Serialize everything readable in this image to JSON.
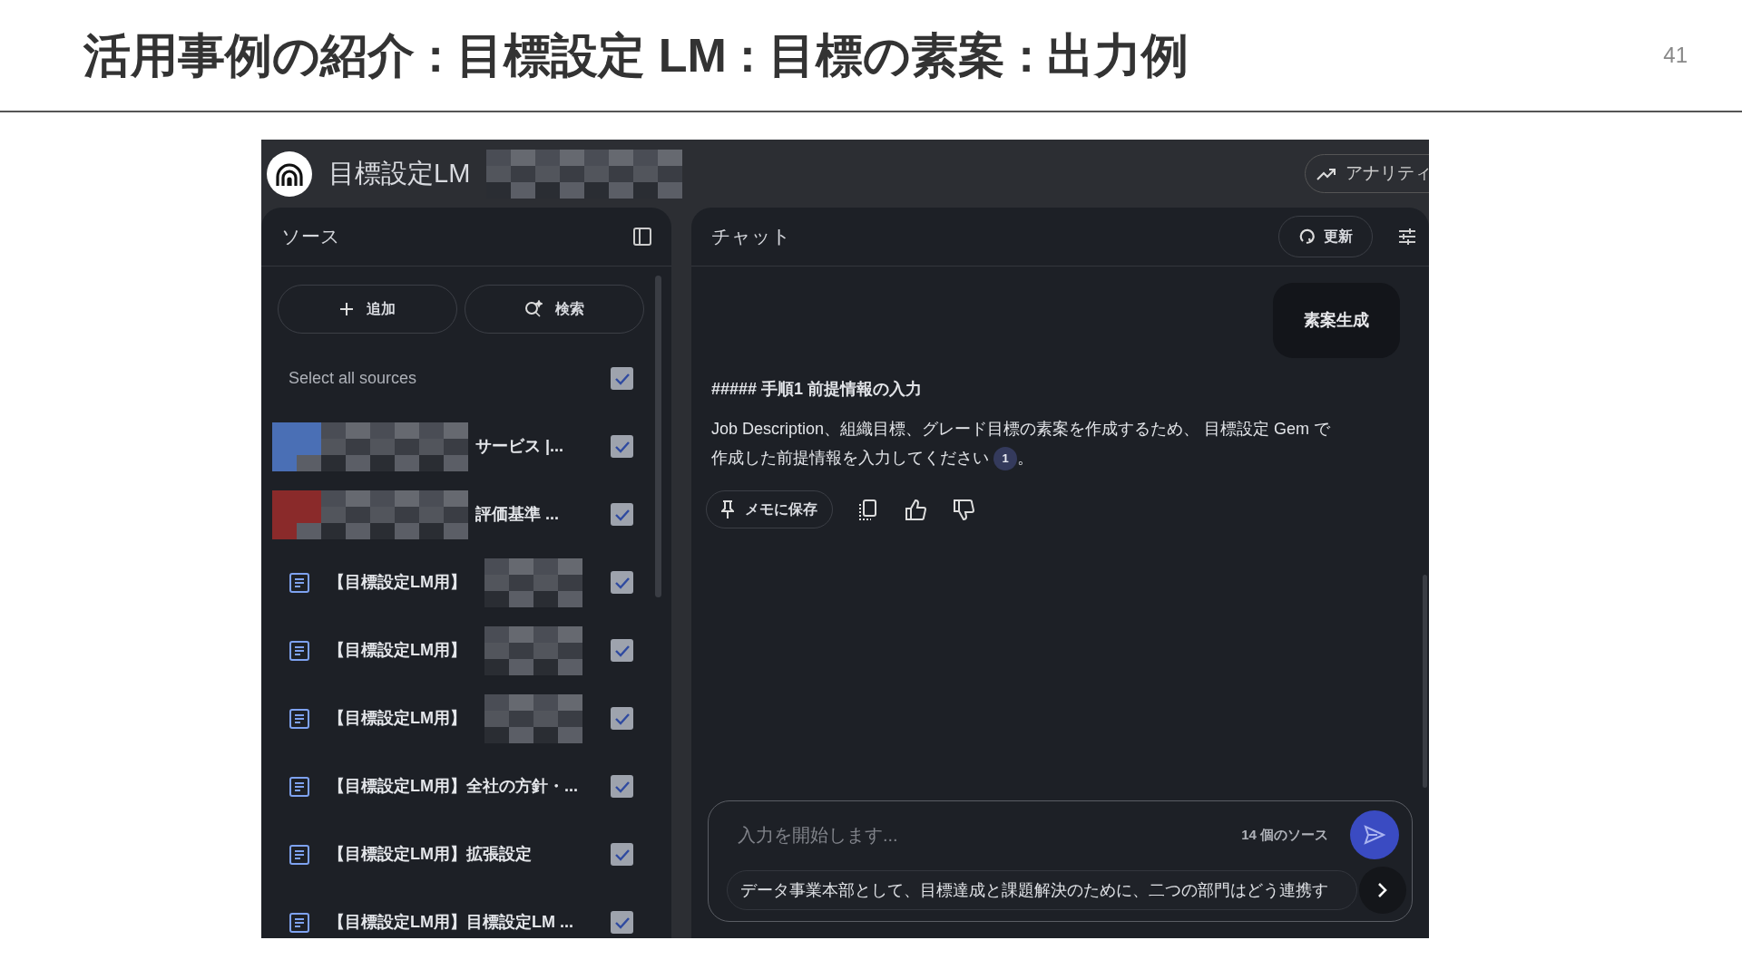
{
  "slide": {
    "title": "活用事例の紹介 : 目標設定 LM : 目標の素案 : 出力例",
    "page_number": "41"
  },
  "app": {
    "title": "目標設定LM",
    "analytics_button": "アナリティ"
  },
  "sources_panel": {
    "title": "ソース",
    "add_button": "追加",
    "search_button": "検索",
    "select_all": {
      "label": "Select all sources",
      "checked": true
    },
    "items": [
      {
        "kind": "redacted",
        "label": "サービス |...",
        "color": "#4a6fb5",
        "checked": true
      },
      {
        "kind": "redacted",
        "label": "評価基準 ...",
        "color": "#8a2a2a",
        "checked": true
      },
      {
        "kind": "doc",
        "label": "【目標設定LM用】",
        "redacted_tail": true,
        "checked": true
      },
      {
        "kind": "doc",
        "label": "【目標設定LM用】",
        "redacted_tail": true,
        "checked": true
      },
      {
        "kind": "doc",
        "label": "【目標設定LM用】",
        "redacted_tail": true,
        "checked": true
      },
      {
        "kind": "doc",
        "label": "【目標設定LM用】全社の方針・...",
        "redacted_tail": false,
        "checked": true
      },
      {
        "kind": "doc",
        "label": "【目標設定LM用】拡張設定",
        "redacted_tail": false,
        "checked": true
      },
      {
        "kind": "doc",
        "label": "【目標設定LM用】目標設定LM ...",
        "redacted_tail": false,
        "checked": true
      }
    ]
  },
  "chat_panel": {
    "title": "チャット",
    "refresh_button": "更新",
    "user_message": "素案生成",
    "response": {
      "heading": "##### 手順1 前提情報の入力",
      "body": "Job Description、組織目標、グレード目標の素案を作成するため、 目標設定 Gem で作成した前提情報を入力してください",
      "citation": "1",
      "body_end": "。"
    },
    "save_note_button": "メモに保存",
    "input": {
      "placeholder": "入力を開始します...",
      "source_count": "14 個のソース",
      "suggestion": "データ事業本部として、目標達成と課題解決のために、二つの部門はどう連携す"
    }
  }
}
